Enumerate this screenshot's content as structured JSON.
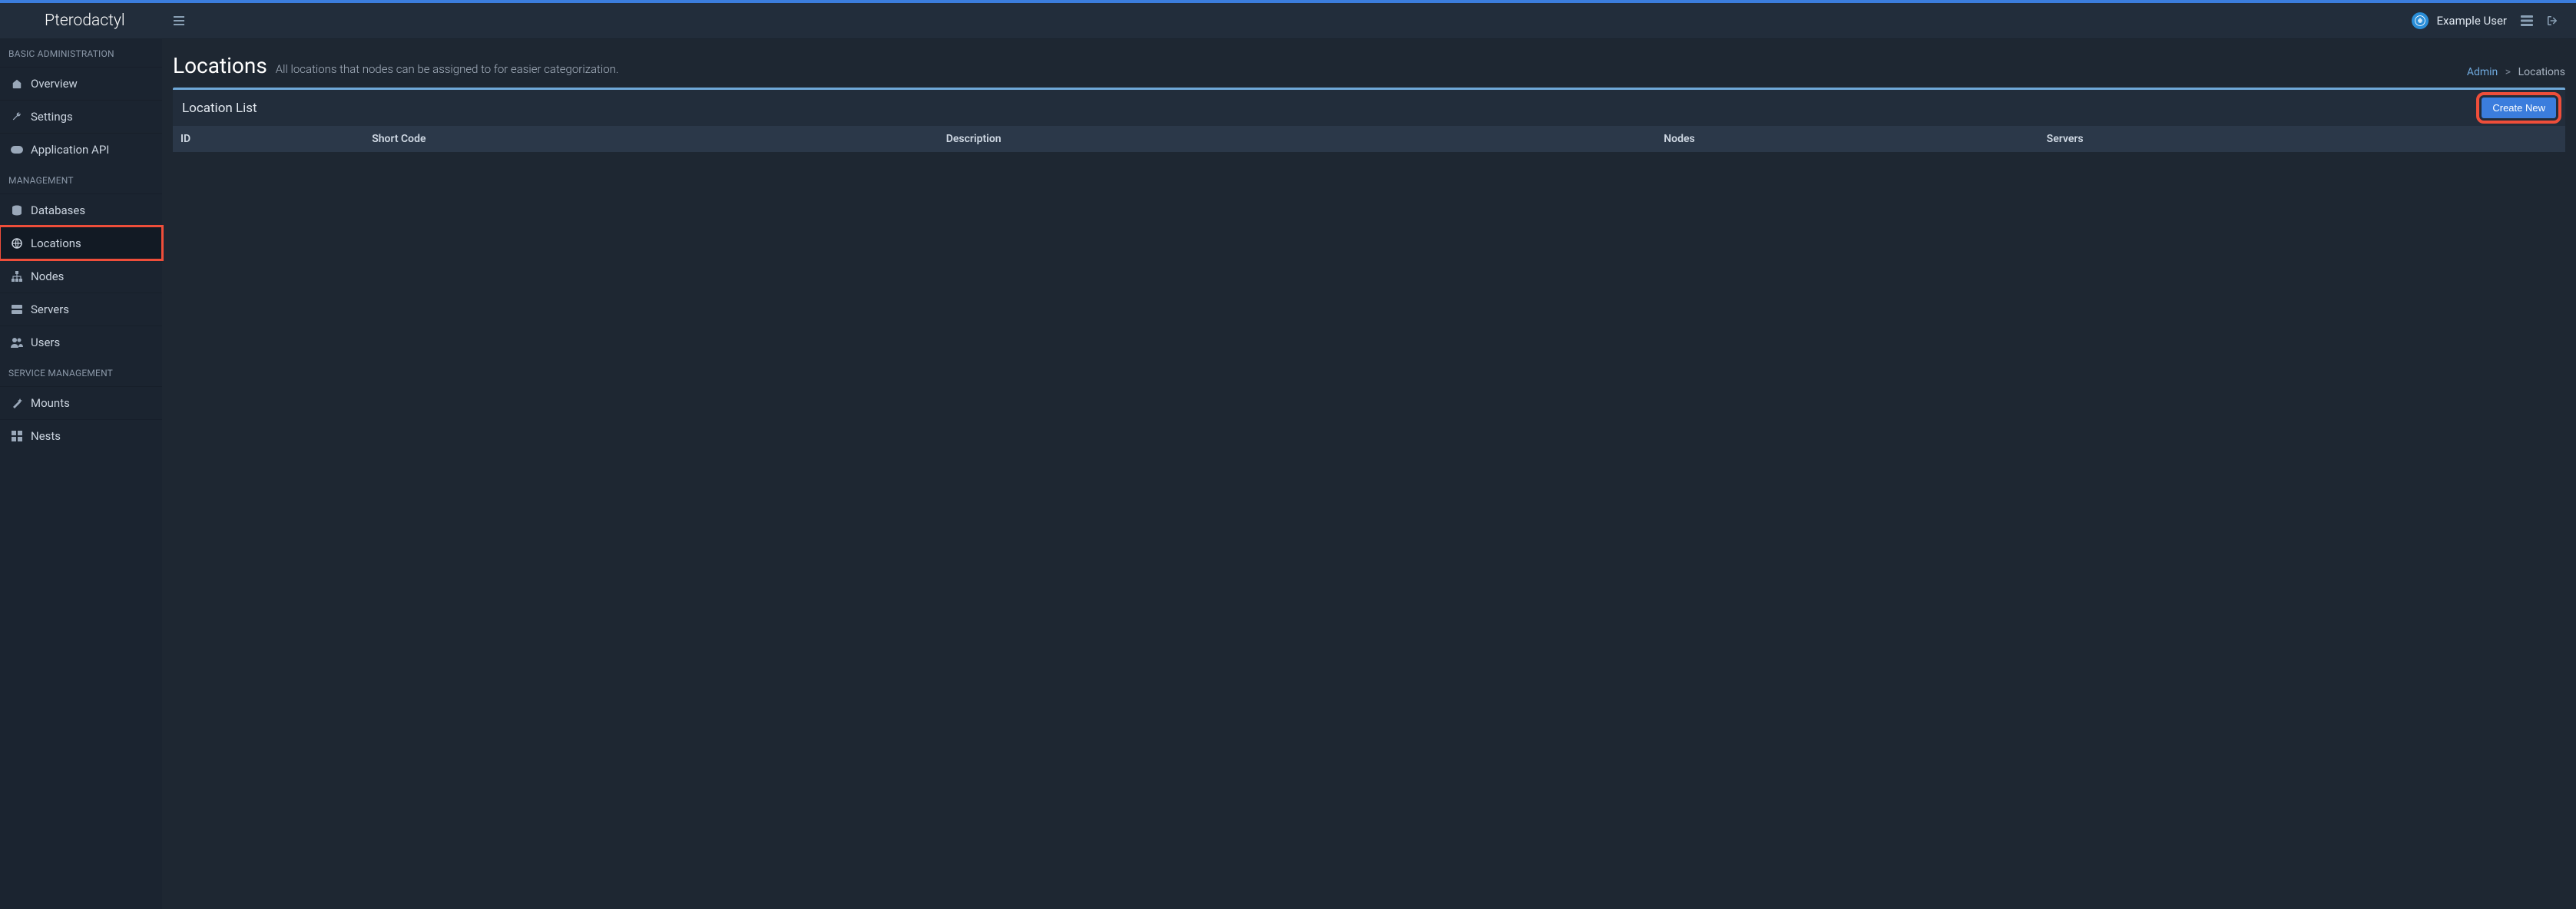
{
  "brand": "Pterodactyl",
  "user": {
    "name": "Example User"
  },
  "sidebar": {
    "sections": [
      {
        "title": "BASIC ADMINISTRATION",
        "items": [
          {
            "label": "Overview"
          },
          {
            "label": "Settings"
          },
          {
            "label": "Application API"
          }
        ]
      },
      {
        "title": "MANAGEMENT",
        "items": [
          {
            "label": "Databases"
          },
          {
            "label": "Locations"
          },
          {
            "label": "Nodes"
          },
          {
            "label": "Servers"
          },
          {
            "label": "Users"
          }
        ]
      },
      {
        "title": "SERVICE MANAGEMENT",
        "items": [
          {
            "label": "Mounts"
          },
          {
            "label": "Nests"
          }
        ]
      }
    ]
  },
  "page": {
    "title": "Locations",
    "subtitle": "All locations that nodes can be assigned to for easier categorization."
  },
  "breadcrumb": {
    "root": "Admin",
    "current": "Locations"
  },
  "panel": {
    "title": "Location List",
    "create_label": "Create New"
  },
  "table": {
    "columns": {
      "id": "ID",
      "short_code": "Short Code",
      "description": "Description",
      "nodes": "Nodes",
      "servers": "Servers"
    },
    "rows": []
  }
}
